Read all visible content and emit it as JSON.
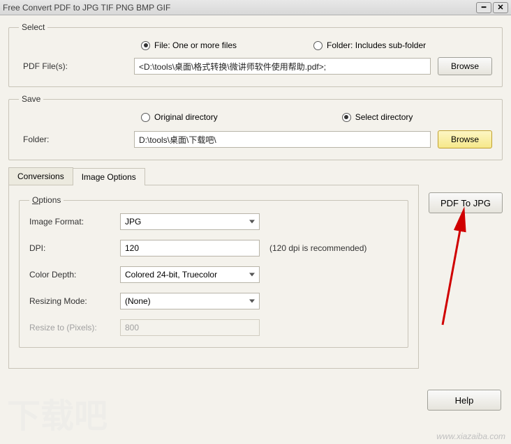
{
  "window": {
    "title": "Free Convert PDF to JPG TIF PNG BMP GIF"
  },
  "select": {
    "legend": "Select",
    "radio_file": "File:  One or more files",
    "radio_folder": "Folder: Includes sub-folder",
    "label_files": "PDF File(s):",
    "path_value": "<D:\\tools\\桌面\\格式转换\\微讲师软件使用帮助.pdf>;",
    "browse": "Browse"
  },
  "save": {
    "legend": "Save",
    "radio_orig": "Original directory",
    "radio_sel": "Select directory",
    "label_folder": "Folder:",
    "path_value": "D:\\tools\\桌面\\下载吧\\",
    "browse": "Browse"
  },
  "tabs": {
    "conversions": "Conversions",
    "image_options": "Image Options"
  },
  "options": {
    "legend_prefix": "O",
    "legend_rest": "ptions",
    "image_format_label": "Image Format:",
    "image_format_value": "JPG",
    "dpi_label": "DPI:",
    "dpi_value": "120",
    "dpi_hint": "(120 dpi is recommended)",
    "color_depth_label": "Color Depth:",
    "color_depth_value": "Colored 24-bit, Truecolor",
    "resize_mode_label": "Resizing Mode:",
    "resize_mode_value": "(None)",
    "resize_to_label": "Resize to (Pixels):",
    "resize_to_value": "800"
  },
  "actions": {
    "convert": "PDF To JPG",
    "help": "Help"
  },
  "watermark": "www.xiazaiba.com"
}
